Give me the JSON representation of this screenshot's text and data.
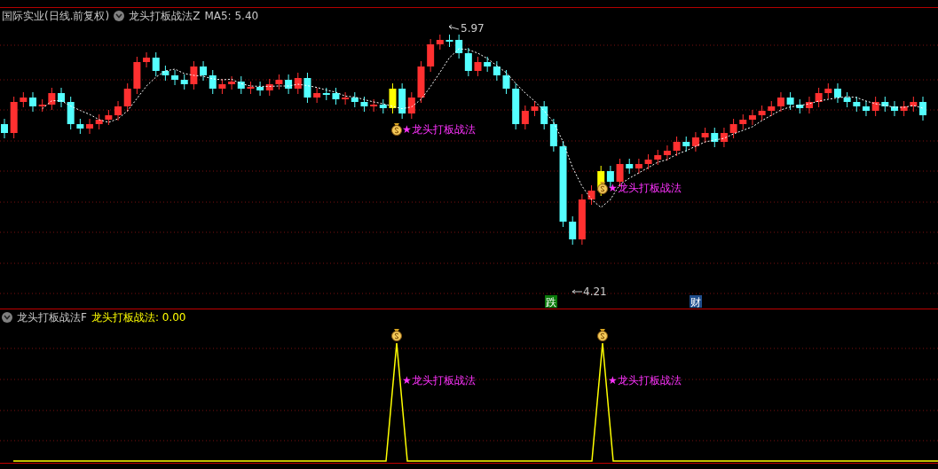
{
  "main_panel": {
    "title": "国际实业(日线.前复权)",
    "indicator": "龙头打板战法Z",
    "ma_reading": "MA5: 5.40",
    "high_label": "5.97",
    "low_label": "4.21",
    "signals": [
      {
        "label": "★龙头打板战法"
      },
      {
        "label": "★龙头打板战法"
      }
    ],
    "event_badges": [
      {
        "label": "跌",
        "color": "#0a7a0a"
      },
      {
        "label": "财",
        "color": "#1f4e8c"
      }
    ]
  },
  "sub_panel": {
    "indicator": "龙头打板战法F",
    "value_label": "龙头打板战法:",
    "value": "0.00",
    "signals": [
      {
        "label": "★龙头打板战法"
      },
      {
        "label": "★龙头打板战法"
      }
    ]
  }
}
